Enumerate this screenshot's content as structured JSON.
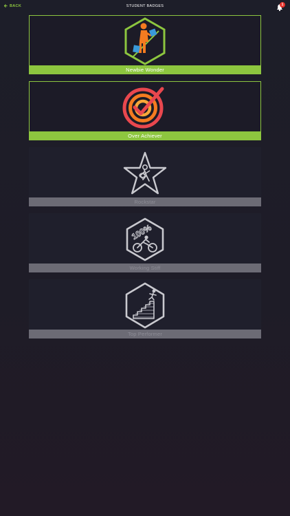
{
  "header": {
    "back_label": "BACK",
    "title": "STUDENT BADGES",
    "notification_count": "1"
  },
  "colors": {
    "accent": "#8dc63f",
    "locked_bar": "#6c6b75",
    "notification": "#e8332c"
  },
  "badges": [
    {
      "name": "Newbie Wonder",
      "status": "earned",
      "icon": "person-reading-hexagon-icon"
    },
    {
      "name": "Over Achiever",
      "status": "earned",
      "icon": "target-checkmark-icon"
    },
    {
      "name": "Rockstar",
      "status": "locked",
      "icon": "star-guitarist-icon"
    },
    {
      "name": "Working Stiff",
      "status": "locked",
      "icon": "cyclist-100-percent-hexagon-icon"
    },
    {
      "name": "Top Performer",
      "status": "locked",
      "icon": "stairs-climber-hexagon-icon"
    }
  ]
}
